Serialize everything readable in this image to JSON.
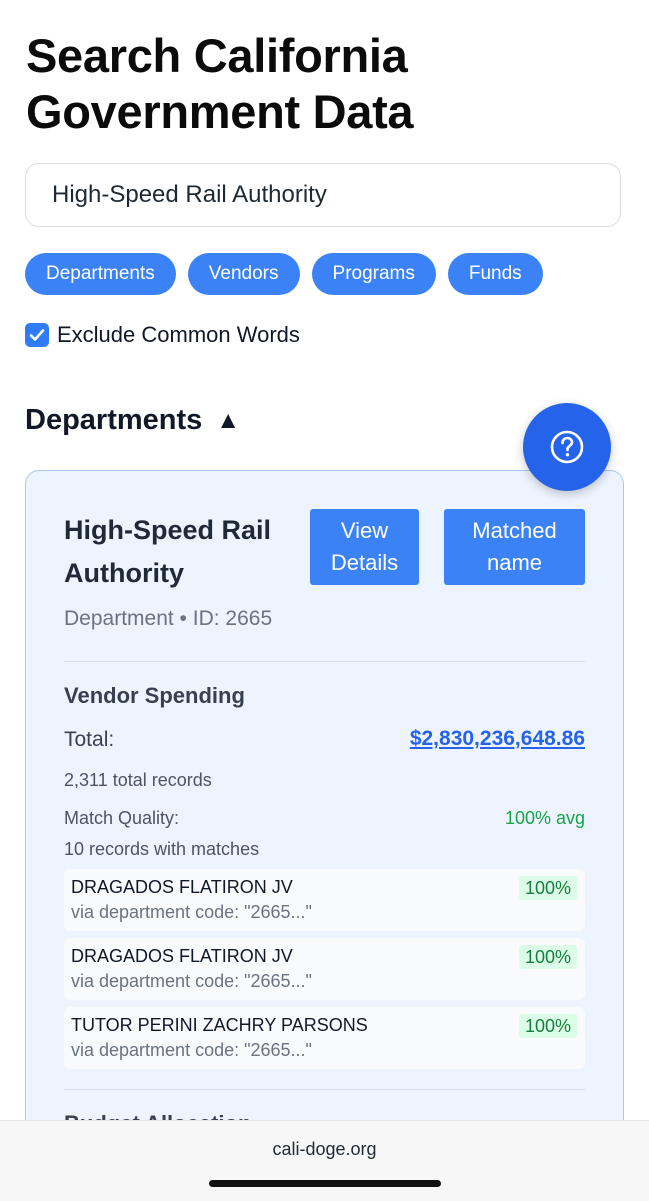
{
  "page": {
    "title": "Search California Government Data"
  },
  "search": {
    "value": "High-Speed Rail Authority"
  },
  "filters": [
    "Departments",
    "Vendors",
    "Programs",
    "Funds"
  ],
  "exclude_common_words": {
    "label": "Exclude Common Words",
    "checked": true
  },
  "section": {
    "title": "Departments",
    "caret": "▲"
  },
  "result": {
    "name": "High-Speed Rail Authority",
    "view_details_label": "View Details",
    "matched_label": "Matched name",
    "meta": "Department • ID: 2665",
    "vendor_spending": {
      "heading": "Vendor Spending",
      "total_label": "Total:",
      "total_value": "$2,830,236,648.86",
      "records": "2,311 total records",
      "match_quality_label": "Match Quality:",
      "match_quality_value": "100% avg",
      "matches_count": "10 records with matches",
      "matches": [
        {
          "name": "DRAGADOS FLATIRON JV",
          "via": "via department code: \"2665...\"",
          "score": "100%"
        },
        {
          "name": "DRAGADOS FLATIRON JV",
          "via": "via department code: \"2665...\"",
          "score": "100%"
        },
        {
          "name": "TUTOR PERINI ZACHRY PARSONS",
          "via": "via department code: \"2665...\"",
          "score": "100%"
        }
      ]
    },
    "next_section_cut": "Budget Allocation"
  },
  "help_button": {
    "icon": "question-circle-icon"
  },
  "browser": {
    "domain": "cali-doge.org"
  },
  "colors": {
    "accent": "#3b82f6",
    "card_background": "#eef4fd",
    "link": "#2563eb",
    "success": "#16a34a"
  }
}
